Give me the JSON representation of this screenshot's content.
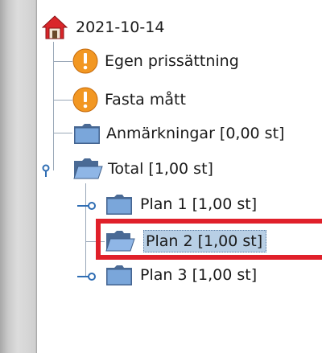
{
  "tree": {
    "root": {
      "label": "2021-10-14",
      "icon": "house-icon"
    },
    "items": [
      {
        "label": "Egen prissättning",
        "icon": "warning-icon"
      },
      {
        "label": "Fasta mått",
        "icon": "warning-icon"
      },
      {
        "label": "Anmärkningar [0,00 st]",
        "icon": "folder-icon"
      },
      {
        "label": "Total [1,00 st]",
        "icon": "folder-open-icon",
        "expanded": true,
        "children": [
          {
            "label": "Plan 1 [1,00 st]",
            "icon": "folder-icon",
            "expanded": false
          },
          {
            "label": "Plan 2 [1,00 st]",
            "icon": "folder-open-icon",
            "selected": true
          },
          {
            "label": "Plan 3 [1,00 st]",
            "icon": "folder-icon",
            "expanded": false
          }
        ]
      }
    ]
  },
  "colors": {
    "selection": "#b8cfe5",
    "highlight_border": "#e0202a",
    "folder_blue": "#6e9bd1",
    "warning_orange": "#f29722",
    "house_red": "#d9262a"
  }
}
